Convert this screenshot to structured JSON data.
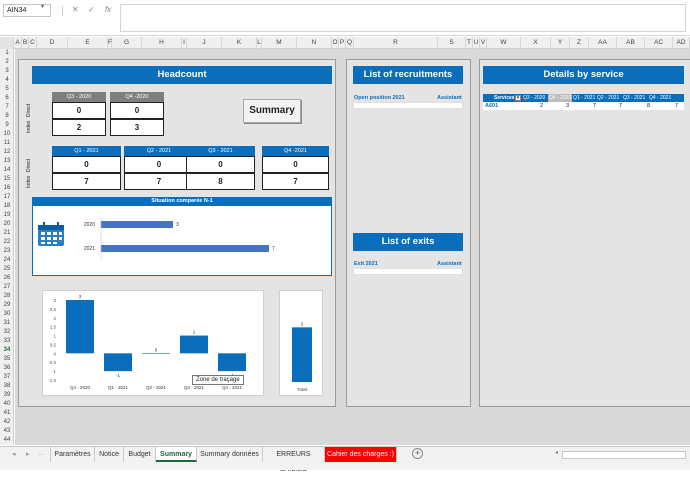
{
  "formula_bar": {
    "name_box": "AIN34",
    "cancel_icon": "✕",
    "enter_icon": "✓",
    "fx": "fx"
  },
  "columns": [
    "A",
    "B",
    "C",
    "D",
    "E",
    "F",
    "G",
    "H",
    "I",
    "J",
    "K",
    "L",
    "M",
    "N",
    "O",
    "P",
    "Q",
    "R",
    "S",
    "T",
    "U",
    "V",
    "W",
    "X",
    "Y",
    "Z",
    "AA",
    "AB",
    "AC",
    "AD"
  ],
  "rows": [
    "1",
    "2",
    "3",
    "4",
    "5",
    "6",
    "7",
    "8",
    "9",
    "10",
    "11",
    "12",
    "13",
    "14",
    "15",
    "16",
    "17",
    "18",
    "19",
    "20",
    "21",
    "22",
    "23",
    "24",
    "25",
    "26",
    "27",
    "28",
    "29",
    "30",
    "31",
    "32",
    "33",
    "34",
    "35",
    "36",
    "37",
    "38",
    "39",
    "40",
    "41",
    "42",
    "43",
    "44"
  ],
  "selected_row": "34",
  "headcount": {
    "title": "Headcount",
    "index_label": "Index",
    "direct_label": "Direct",
    "top": [
      {
        "label": "Q3 - 2020",
        "index": "0",
        "direct": "2"
      },
      {
        "label": "Q4 -2020",
        "index": "0",
        "direct": "3"
      }
    ],
    "bottom": [
      {
        "label": "Q1 - 2021",
        "index": "0",
        "direct": "7"
      },
      {
        "label": "Q2 - 2021",
        "index": "0",
        "direct": "7"
      },
      {
        "label": "Q3 - 2021",
        "index": "0",
        "direct": "8"
      },
      {
        "label": "Q4 -2021",
        "index": "0",
        "direct": "7"
      }
    ],
    "summary_button": "Summary",
    "comparison_title": "Situation comparée N-1"
  },
  "comparison_chart": {
    "type": "bar",
    "categories": [
      "2020",
      "2021"
    ],
    "values": [
      3,
      7
    ],
    "xlim": [
      0,
      7
    ]
  },
  "variation_chart": {
    "type": "bar",
    "categories": [
      "Q4 - 2020",
      "Q1 - 2021",
      "Q2 - 2021",
      "Q3 - 2021",
      "Q4 - 2021"
    ],
    "values": [
      3,
      -1,
      0,
      1,
      -1
    ],
    "y_ticks": [
      "3",
      "2,5",
      "2",
      "1,5",
      "1",
      "0,5",
      "0",
      "-0,5",
      "-1",
      "-1,5"
    ],
    "ylim": [
      -1.5,
      3
    ],
    "tooltip": "Zone de traçage"
  },
  "total_chart": {
    "type": "bar",
    "categories": [
      "Total"
    ],
    "values": [
      2
    ],
    "ylim": [
      0,
      3
    ]
  },
  "recruitments": {
    "title": "List of recruitments",
    "col1": "Open position 2021",
    "col2": "Assistant"
  },
  "exits": {
    "title": "List of exits",
    "col1": "Exit 2021",
    "col2": "Assistant"
  },
  "details": {
    "title": "Details by service",
    "headers": [
      "Services",
      "Q3 - 2020",
      "Q4 - 2020",
      "Q1 - 2021",
      "Q2 - 2021",
      "Q3 - 2021",
      "Q4 - 2021"
    ],
    "rows": [
      {
        "service": "A601",
        "values": [
          "2",
          "3",
          "7",
          "7",
          "8",
          "7"
        ]
      }
    ]
  },
  "tabs": [
    {
      "label": "Paramètres"
    },
    {
      "label": "Notice"
    },
    {
      "label": "Budget"
    },
    {
      "label": "Summary"
    },
    {
      "label": "Summary données"
    },
    {
      "label": "ERREURS SAISIES"
    },
    {
      "label": "Cahier des charges :)"
    }
  ],
  "add_sheet_icon": "+",
  "colors": {
    "accent_blue": "#0a6ebd",
    "header_grey": "#7f7f7f",
    "bar_blue": "#0a6ebd",
    "tab_red": "#ff0000",
    "excel_green": "#1d6b3c"
  }
}
